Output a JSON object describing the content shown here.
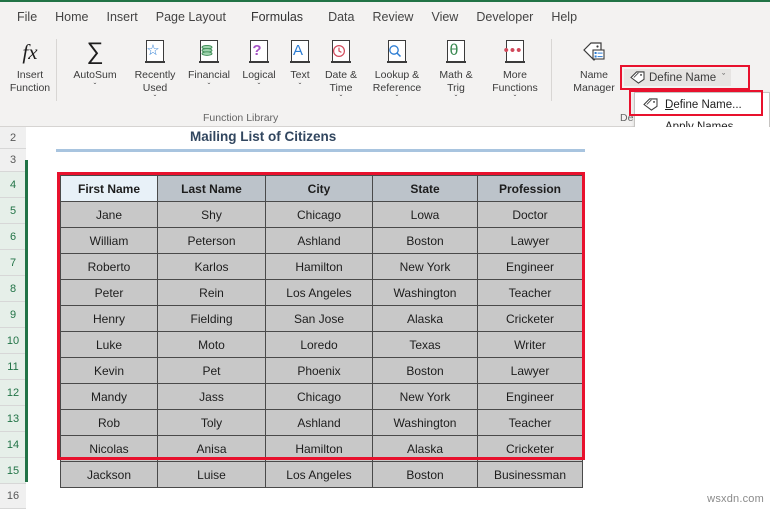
{
  "ribbon_tabs": [
    {
      "label": "File",
      "annotated": false
    },
    {
      "label": "Home",
      "annotated": false
    },
    {
      "label": "Insert",
      "annotated": false
    },
    {
      "label": "Page Layout",
      "annotated": false
    },
    {
      "label": "Formulas",
      "annotated": true
    },
    {
      "label": "Data",
      "annotated": false
    },
    {
      "label": "Review",
      "annotated": false
    },
    {
      "label": "View",
      "annotated": false
    },
    {
      "label": "Developer",
      "annotated": false
    },
    {
      "label": "Help",
      "annotated": false
    }
  ],
  "ribbon": {
    "groups": [
      {
        "label": "Function Library"
      },
      {
        "label": "Defined Names"
      }
    ],
    "function_library": [
      {
        "label": "Insert\nFunction",
        "icon": "fx-icon",
        "glyph": "fx",
        "color": "#1d1d1d",
        "chevron": false
      },
      {
        "label": "AutoSum",
        "icon": "sigma-icon",
        "glyph": "∑",
        "color": "#1d1d1d",
        "chevron": true
      },
      {
        "label": "Recently\nUsed",
        "icon": "star-icon",
        "glyph": "☆",
        "color": "#2b7cd3",
        "chevron": true
      },
      {
        "label": "Financial",
        "icon": "coins-icon",
        "glyph": "☰",
        "color": "#3a8a52",
        "chevron": true
      },
      {
        "label": "Logical",
        "icon": "question-icon",
        "glyph": "?",
        "color": "#a452c4",
        "chevron": true
      },
      {
        "label": "Text",
        "icon": "letter-a-icon",
        "glyph": "A",
        "color": "#2b7cd3",
        "chevron": true
      },
      {
        "label": "Date &\nTime",
        "icon": "clock-icon",
        "glyph": "◴",
        "color": "#d1495b",
        "chevron": true
      },
      {
        "label": "Lookup &\nReference",
        "icon": "magnifier-icon",
        "glyph": "⚲",
        "color": "#2b7cd3",
        "chevron": true
      },
      {
        "label": "Math &\nTrig",
        "icon": "theta-icon",
        "glyph": "θ",
        "color": "#3a8a52",
        "chevron": true
      },
      {
        "label": "More\nFunctions",
        "icon": "ellipsis-icon",
        "glyph": "···",
        "color": "#d1495b",
        "chevron": true
      }
    ],
    "defined_names": {
      "name_manager_label": "Name\nManager",
      "name_manager_icon": "tag-list-icon",
      "define_name_button": "Define Name",
      "define_name_icon": "tag-icon",
      "define_name_chevron": "ˇ",
      "menu_items": [
        {
          "label_underlined": "D",
          "label_rest": "efine Name...",
          "icon": "tag-icon",
          "annotated": true
        },
        {
          "label_underlined": "A",
          "label_rest": "pply Names...",
          "icon": "none",
          "annotated": false
        }
      ]
    }
  },
  "sheet": {
    "row_headers": [
      "2",
      "3",
      "4",
      "5",
      "6",
      "7",
      "8",
      "9",
      "10",
      "11",
      "12",
      "13",
      "14",
      "15",
      "16"
    ],
    "selected_rows": [
      "4",
      "5",
      "6",
      "7",
      "8",
      "9",
      "10",
      "11",
      "12",
      "13",
      "14",
      "15"
    ],
    "title": "Mailing List of Citizens",
    "table": {
      "headers": [
        "First Name",
        "Last Name",
        "City",
        "State",
        "Profession"
      ],
      "active_header_index": 0,
      "rows": [
        [
          "Jane",
          "Shy",
          "Chicago",
          "Lowa",
          "Doctor"
        ],
        [
          "William",
          "Peterson",
          "Ashland",
          "Boston",
          "Lawyer"
        ],
        [
          "Roberto",
          "Karlos",
          "Hamilton",
          "New York",
          "Engineer"
        ],
        [
          "Peter",
          "Rein",
          "Los Angeles",
          "Washington",
          "Teacher"
        ],
        [
          "Henry",
          "Fielding",
          "San Jose",
          "Alaska",
          "Cricketer"
        ],
        [
          "Luke",
          "Moto",
          "Loredo",
          "Texas",
          "Writer"
        ],
        [
          "Kevin",
          "Pet",
          "Phoenix",
          "Boston",
          "Lawyer"
        ],
        [
          "Mandy",
          "Jass",
          "Chicago",
          "New York",
          "Engineer"
        ],
        [
          "Rob",
          "Toly",
          "Ashland",
          "Washington",
          "Teacher"
        ],
        [
          "Nicolas",
          "Anisa",
          "Hamilton",
          "Alaska",
          "Cricketer"
        ],
        [
          "Jackson",
          "Luise",
          "Los Angeles",
          "Boston",
          "Businessman"
        ]
      ]
    }
  },
  "watermark": "wsxdn.com",
  "colors": {
    "annotation_red": "#e8112d",
    "excel_green": "#217346",
    "title_navy": "#31465f",
    "cell_gray": "#c8c8c8",
    "header_gray": "#bcc3ca",
    "active_cell": "#e8f1f8"
  }
}
